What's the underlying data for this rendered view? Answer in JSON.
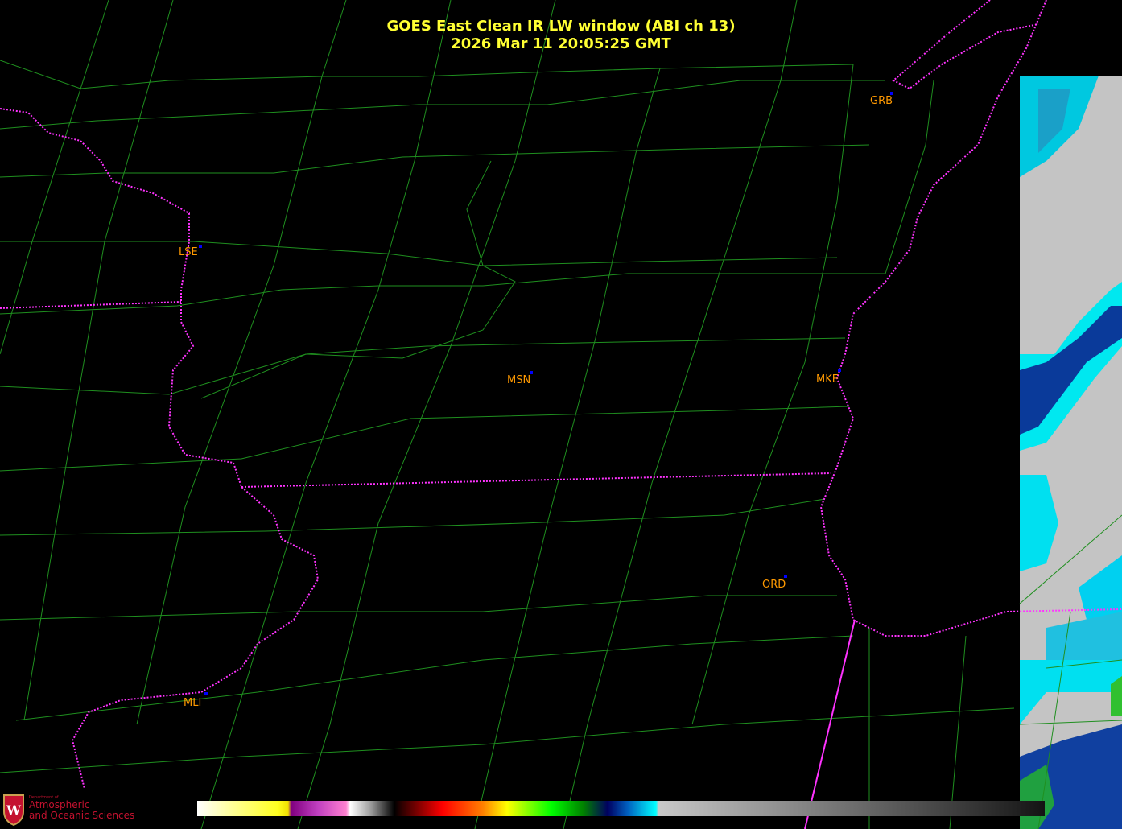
{
  "title": {
    "line1": "GOES East Clean IR LW window (ABI ch 13)",
    "line2": "2026 Mar 11  20:05:25 GMT"
  },
  "stations": [
    {
      "id": "LSE"
    },
    {
      "id": "MSN"
    },
    {
      "id": "MKE"
    },
    {
      "id": "GRB"
    },
    {
      "id": "ORD"
    },
    {
      "id": "MLI"
    }
  ],
  "colors": {
    "county_lines": "#1f8f1f",
    "state_lines": "#ff33ff",
    "station_label": "#ff9900",
    "title": "#ffff33"
  },
  "logo": {
    "line1": "Department of",
    "line2": "Atmospheric",
    "line3": "and Oceanic Sciences",
    "emblem": "W"
  }
}
